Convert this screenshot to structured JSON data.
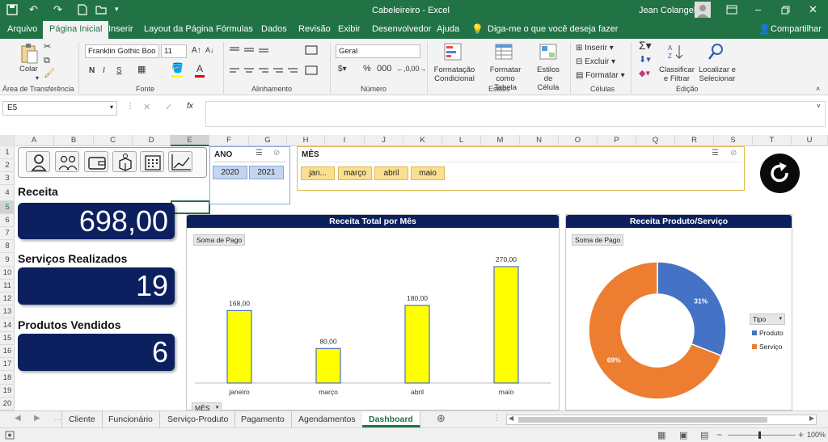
{
  "window": {
    "title": "Cabeleireiro  -  Excel",
    "user": "Jean Colangelo"
  },
  "ribbon_tabs": [
    "Arquivo",
    "Página Inicial",
    "Inserir",
    "Layout da Página",
    "Fórmulas",
    "Dados",
    "Revisão",
    "Exibir",
    "Desenvolvedor",
    "Ajuda"
  ],
  "tell_me": "Diga-me o que você deseja fazer",
  "share_label": "Compartilhar",
  "ribbon": {
    "paste_label": "Colar",
    "clipboard_group": "Área de Transferência",
    "font_name": "Franklin Gothic Boo",
    "font_size": "11",
    "bold": "N",
    "italic": "I",
    "underline": "S",
    "font_group": "Fonte",
    "alignment_group": "Alinhamento",
    "number_format": "Geral",
    "number_group": "Número",
    "cond_format_1": "Formatação",
    "cond_format_2": "Condicional",
    "format_table_1": "Formatar como",
    "format_table_2": "Tabela",
    "cell_styles_1": "Estilos de",
    "cell_styles_2": "Célula",
    "styles_group": "Estilos",
    "insert_label": "Inserir",
    "delete_label": "Excluir",
    "format_label": "Formatar",
    "cells_group": "Células",
    "sort_1": "Classificar",
    "sort_2": "e Filtrar",
    "find_1": "Localizar e",
    "find_2": "Selecionar",
    "editing_group": "Edição"
  },
  "formula_bar": {
    "name_box": "E5",
    "fx": "fx",
    "formula": ""
  },
  "columns": [
    "A",
    "B",
    "C",
    "D",
    "E",
    "F",
    "G",
    "H",
    "I",
    "J",
    "K",
    "L",
    "M",
    "N",
    "O",
    "P",
    "Q",
    "R",
    "S",
    "T",
    "U"
  ],
  "rows": [
    "1",
    "2",
    "3",
    "4",
    "5",
    "6",
    "7",
    "8",
    "9",
    "10",
    "11",
    "12",
    "13",
    "14",
    "15",
    "16",
    "17",
    "18",
    "19",
    "20"
  ],
  "dashboard": {
    "kpis": [
      {
        "label": "Receita",
        "value": "698,00"
      },
      {
        "label": "Serviços Realizados",
        "value": "19"
      },
      {
        "label": "Produtos Vendidos",
        "value": "6"
      }
    ],
    "ano_slicer": {
      "title": "ANO",
      "items": [
        "2020",
        "2021"
      ]
    },
    "mes_slicer": {
      "title": "MÊS",
      "items": [
        "jan...",
        "março",
        "abril",
        "maio"
      ]
    },
    "nav_icons": [
      "person-icon",
      "group-icon",
      "wallet-icon",
      "box-icon",
      "calendar-icon",
      "chart-line-icon"
    ]
  },
  "chart_data": [
    {
      "type": "bar",
      "title": "Receita Total por Mês",
      "field_button": "Soma de Pago",
      "axis_button": "MÊS",
      "categories": [
        "janeiro",
        "março",
        "abril",
        "maio"
      ],
      "values": [
        168,
        80,
        180,
        270
      ],
      "data_labels": [
        "168,00",
        "80,00",
        "180,00",
        "270,00"
      ],
      "ylim": [
        0,
        270
      ],
      "color": "#ffff00"
    },
    {
      "type": "pie",
      "title": "Receita Produto/Serviço",
      "field_button": "Soma de Pago",
      "legend_title": "Tipo",
      "legend_position": "right",
      "series": [
        {
          "name": "Produto",
          "value": 31,
          "label": "31%",
          "color": "#4472c4"
        },
        {
          "name": "Serviço",
          "value": 69,
          "label": "69%",
          "color": "#ed7d31"
        }
      ]
    }
  ],
  "sheet_tabs": [
    "Cliente",
    "Funcionário",
    "Serviço-Produto",
    "Pagamento",
    "Agendamentos",
    "Dashboard"
  ],
  "active_sheet": "Dashboard",
  "status": {
    "zoom": "100%"
  }
}
